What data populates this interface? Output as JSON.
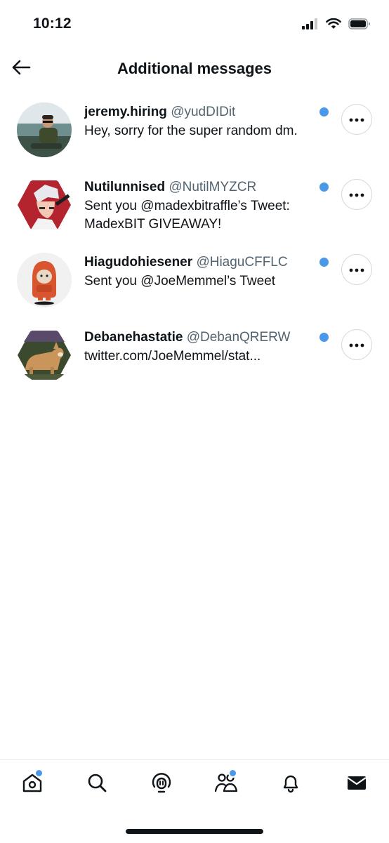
{
  "status_bar": {
    "time": "10:12"
  },
  "header": {
    "title": "Additional messages"
  },
  "messages": [
    {
      "name": "jeremy.hiring",
      "handle": "@yudDIDit",
      "text": "Hey, sorry for the super random dm.",
      "unread": true
    },
    {
      "name": "Nutilunnised",
      "handle": "@NutilMYZCR",
      "text": "Sent you @madexbitraffle’s Tweet: MadexBIT GIVEAWAY!",
      "unread": true
    },
    {
      "name": "Hiagudohiesener",
      "handle": "@HiaguCFFLC",
      "text": "Sent you @JoeMemmel’s Tweet",
      "unread": true
    },
    {
      "name": "Debanehastatie",
      "handle": "@DebanQRERW",
      "text": "twitter.com/JoeMemmel/stat...",
      "unread": true
    }
  ],
  "tabbar": {
    "tabs": [
      "home-icon",
      "search-icon",
      "spaces-icon",
      "communities-icon",
      "notifications-icon",
      "messages-icon"
    ],
    "badges": {
      "home": true,
      "communities": true
    }
  },
  "colors": {
    "accent": "#4a99e9",
    "text": "#0f1419",
    "secondary": "#536471",
    "border": "#cfd9de"
  }
}
